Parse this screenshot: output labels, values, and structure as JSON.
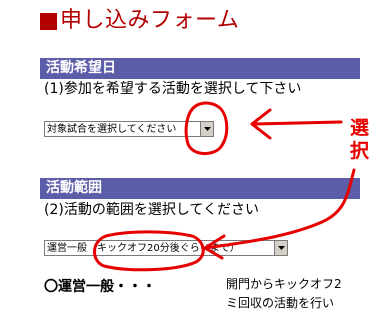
{
  "form": {
    "title": "申し込みフォーム"
  },
  "section1": {
    "header": "活動希望日",
    "instruction": "(1)参加を希望する活動を選択して下さい",
    "select_value": "対象試合を選択してください"
  },
  "section2": {
    "header": "活動範囲",
    "instruction": "(2)活動の範囲を選択してください",
    "select_value": "運営一般（キックオフ20分後ぐらいまで）"
  },
  "annotation": {
    "char1": "選",
    "char2": "択",
    "color": "#e60000"
  },
  "bullet": {
    "text": "〇運営一般・・・"
  },
  "description": {
    "line1": "開門からキックオフ2",
    "line2": "ミ回収の活動を行い"
  },
  "colors": {
    "title": "#b30000",
    "section_header_bg": "#5b5da9"
  }
}
